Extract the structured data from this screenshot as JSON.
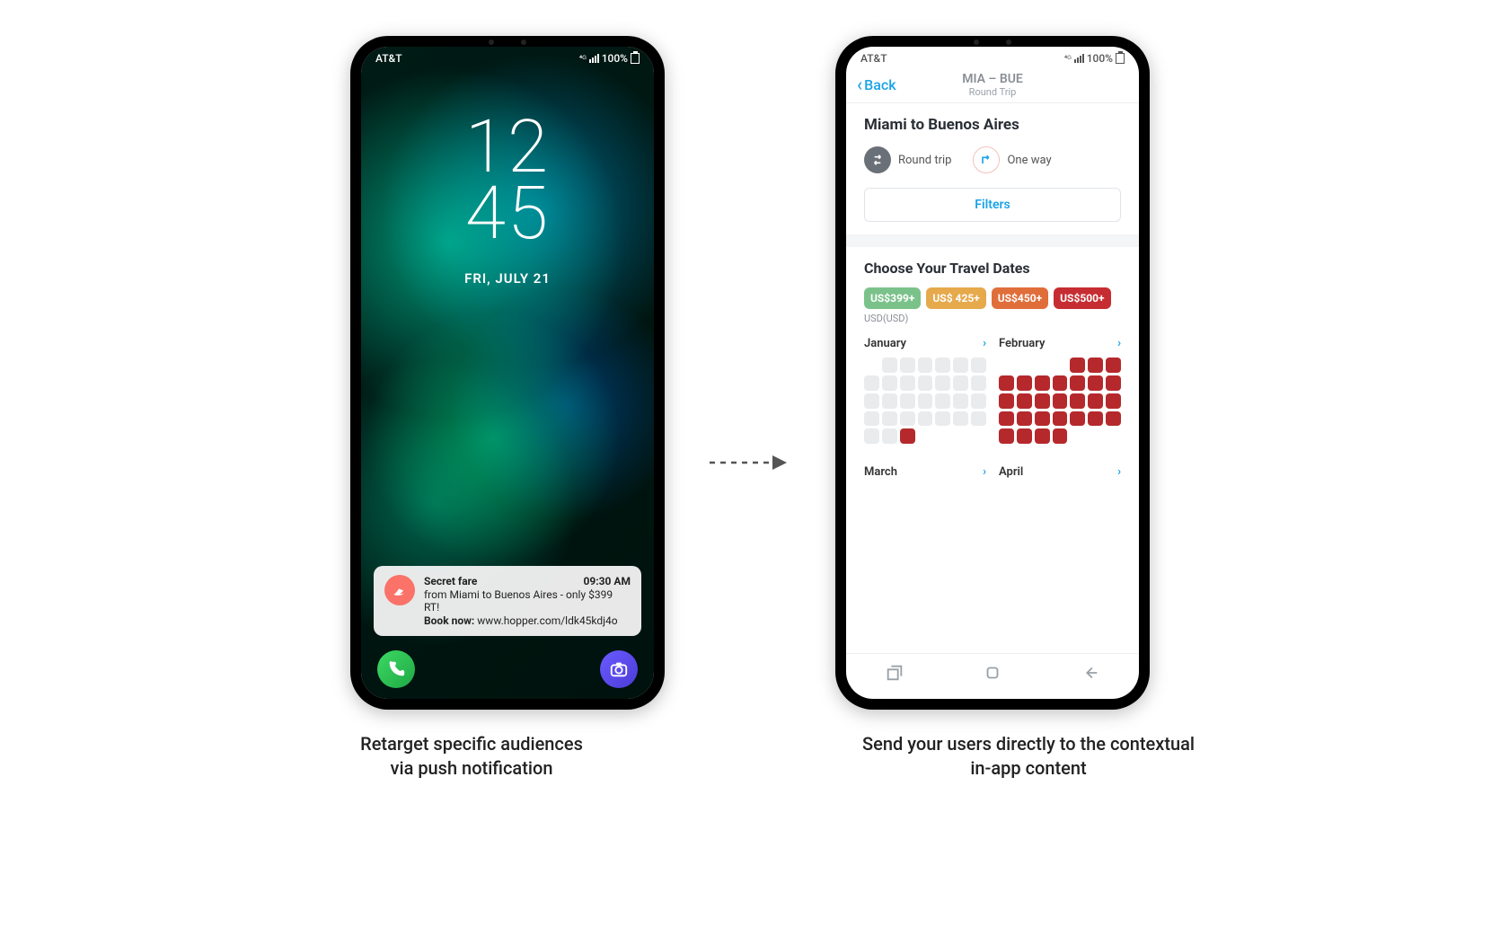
{
  "status": {
    "carrier": "AT&T",
    "battery_text": "100%"
  },
  "lockscreen": {
    "time_top": "12",
    "time_bottom": "45",
    "date": "FRI, JULY 21",
    "notification": {
      "title": "Secret fare",
      "time": "09:30 AM",
      "line1": "from Miami to Buenos Aires - only $399 RT!",
      "line2_label": "Book now:",
      "line2_url": "www.hopper.com/ldk45kdj4o"
    },
    "dock": {
      "phone_icon": "phone-icon",
      "camera_icon": "camera-icon"
    }
  },
  "app": {
    "nav": {
      "back_label": "Back",
      "route_code": "MIA – BUE",
      "trip_kind": "Round Trip"
    },
    "route_title": "Miami to Buenos Aires",
    "trip_options": {
      "round_trip": "Round trip",
      "one_way": "One way"
    },
    "filters_label": "Filters",
    "dates_title": "Choose Your Travel Dates",
    "price_tiers": [
      "US$399+",
      "US$ 425+",
      "US$450+",
      "US$500+"
    ],
    "currency_note": "USD(USD)",
    "months": [
      {
        "name": "January"
      },
      {
        "name": "February"
      },
      {
        "name": "March"
      },
      {
        "name": "April"
      }
    ]
  },
  "captions": {
    "left_line1": "Retarget specific audiences",
    "left_line2": "via push notification",
    "right_line1": "Send your users directly to the contextual",
    "right_line2": "in-app content"
  }
}
